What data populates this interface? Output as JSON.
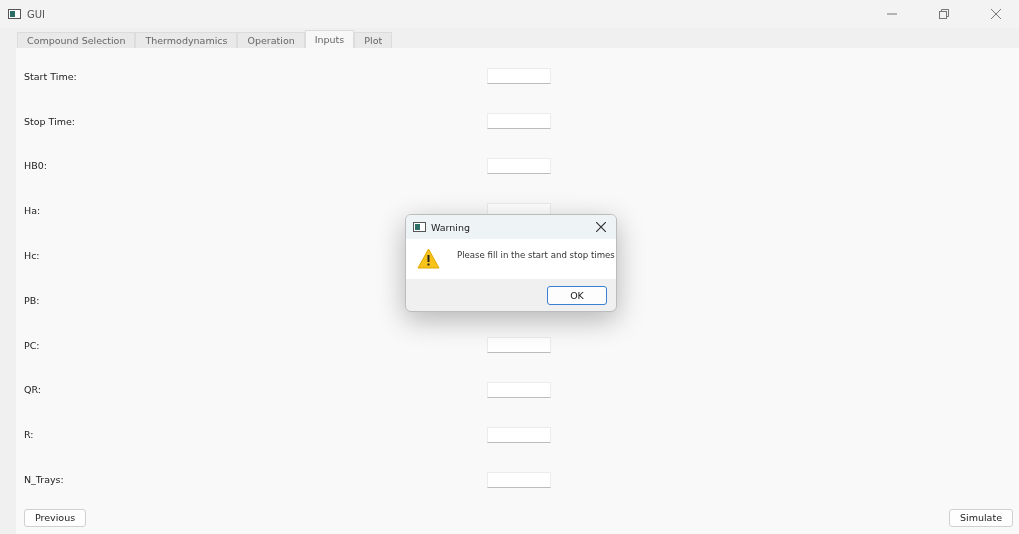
{
  "window": {
    "title": "GUI"
  },
  "tabs": [
    {
      "label": "Compound Selection",
      "selected": false
    },
    {
      "label": "Thermodynamics",
      "selected": false
    },
    {
      "label": "Operation",
      "selected": false
    },
    {
      "label": "Inputs",
      "selected": true
    },
    {
      "label": "Plot",
      "selected": false
    }
  ],
  "fields": [
    {
      "label": "Start Time:",
      "input": true
    },
    {
      "label": "Stop Time:",
      "input": true
    },
    {
      "label": "HB0:",
      "input": true
    },
    {
      "label": "Ha:",
      "input": true
    },
    {
      "label": "Hc:"
    },
    {
      "label": "PB:"
    },
    {
      "label": "PC:",
      "input": true
    },
    {
      "label": "QR:",
      "input": true
    },
    {
      "label": "R:",
      "input": true
    },
    {
      "label": "N_Trays:",
      "input": true
    }
  ],
  "buttons": {
    "previous": "Previous",
    "simulate": "Simulate"
  },
  "dialog": {
    "title": "Warning",
    "message": "Please fill in the start and stop times",
    "button": "OK"
  }
}
